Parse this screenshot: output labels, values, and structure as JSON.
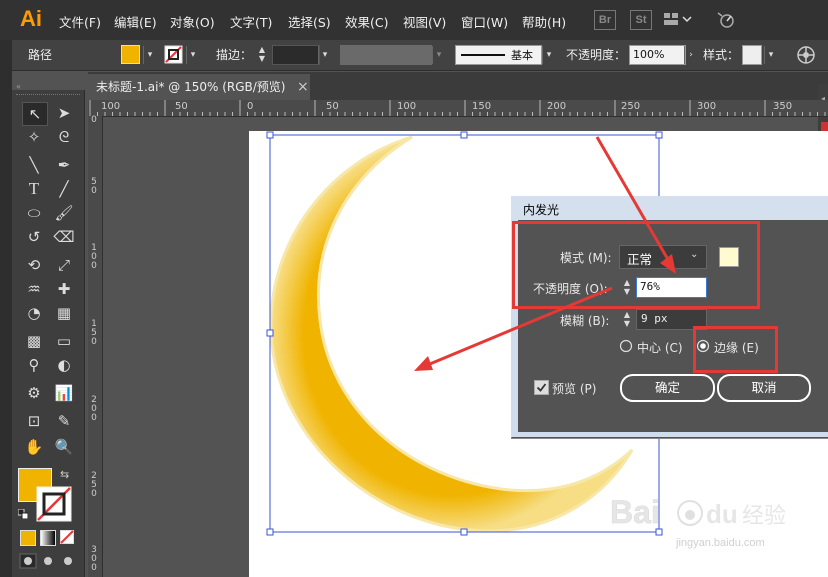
{
  "app": {
    "logo": "Ai"
  },
  "menu": [
    "文件(F)",
    "编辑(E)",
    "对象(O)",
    "文字(T)",
    "选择(S)",
    "效果(C)",
    "视图(V)",
    "窗口(W)",
    "帮助(H)"
  ],
  "menu_icons": {
    "bridge": "Br",
    "stock": "St"
  },
  "control": {
    "selection_label": "路径",
    "stroke_label": "描边：",
    "stroke_style": "基本",
    "opacity_label": "不透明度：",
    "opacity_value": "100%",
    "style_label": "样式："
  },
  "tab": {
    "title": "未标题-1.ai* @ 150% (RGB/预览)",
    "close": "×"
  },
  "ruler": {
    "h": [
      "100",
      "50",
      "0",
      "50",
      "100",
      "150",
      "200",
      "250",
      "300",
      "350"
    ],
    "v": [
      [
        "0"
      ],
      [
        "5",
        "0"
      ],
      [
        "1",
        "0",
        "0"
      ],
      [
        "1",
        "5",
        "0"
      ],
      [
        "2",
        "0",
        "0"
      ],
      [
        "2",
        "5",
        "0"
      ],
      [
        "3",
        "0",
        "0"
      ]
    ]
  },
  "dialog": {
    "title": "内发光",
    "mode_label": "模式 (M):",
    "mode_value": "正常",
    "opacity_label": "不透明度 (O):",
    "opacity_value": "76%",
    "blur_label": "模糊 (B):",
    "blur_value": "9 px",
    "center_label": "中心 (C)",
    "edge_label": "边缘 (E)",
    "preview_label": "预览 (P)",
    "ok_label": "确定",
    "cancel_label": "取消",
    "glow_color": "#fffad0",
    "selected_source": "edge",
    "preview_checked": true
  },
  "colors": {
    "fill": "#f0b400",
    "moon": "#f0b400",
    "annotation": "#e53935",
    "selection": "#3a55d8"
  },
  "watermark": {
    "brand": "Baidu经验",
    "url": "jingyan.baidu.com"
  }
}
